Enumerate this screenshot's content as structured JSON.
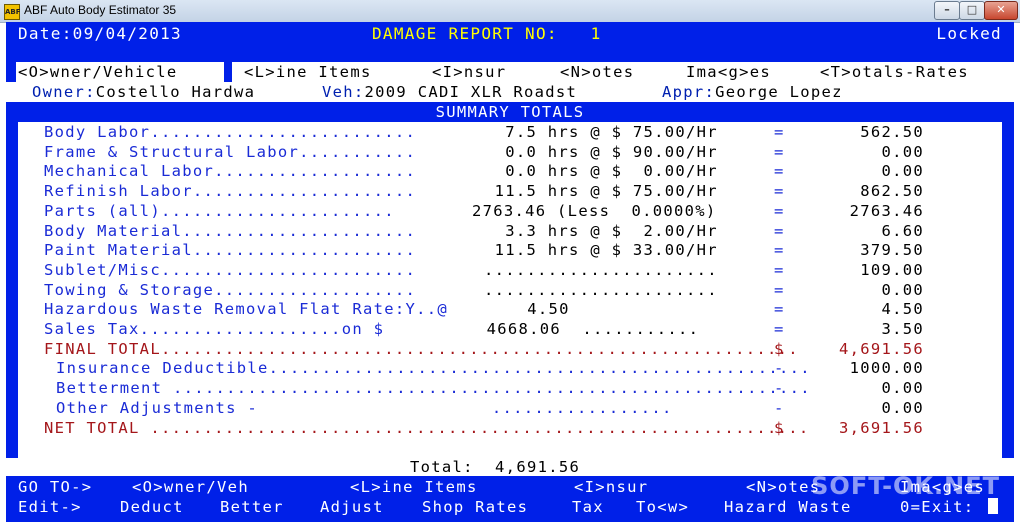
{
  "window": {
    "title": "ABF Auto Body Estimator 35",
    "icon": "abf-app-icon",
    "icon_text": "ABF"
  },
  "header": {
    "date": "Date:09/04/2013",
    "report": "DAMAGE REPORT NO:   1",
    "status": "Locked"
  },
  "tabs": [
    {
      "label": "<O>wner/Vehicle"
    },
    {
      "label": "<L>ine Items"
    },
    {
      "label": "<I>nsur"
    },
    {
      "label": "<N>otes"
    },
    {
      "label": "Ima<g>es"
    },
    {
      "label": "<T>otals-Rates"
    }
  ],
  "info": {
    "owner_label": "Owner:",
    "owner": "Costello Hardwa",
    "veh_label": "Veh:",
    "veh": "2009 CADI XLR Roadst",
    "appr_label": "Appr:",
    "appr": "George Lopez"
  },
  "summary_title": "SUMMARY TOTALS",
  "rows": [
    {
      "label": "Body Labor.........................",
      "mid": "  7.5 hrs @ $ 75.00/Hr",
      "eq": "=",
      "amount": "562.50"
    },
    {
      "label": "Frame & Structural Labor...........",
      "mid": "  0.0 hrs @ $ 90.00/Hr",
      "eq": "=",
      "amount": "0.00"
    },
    {
      "label": "Mechanical Labor...................",
      "mid": "  0.0 hrs @ $  0.00/Hr",
      "eq": "=",
      "amount": "0.00"
    },
    {
      "label": "Refinish Labor.....................",
      "mid": " 11.5 hrs @ $ 75.00/Hr",
      "eq": "=",
      "amount": "862.50"
    },
    {
      "label": "Parts (all)......................",
      "mid": "2763.46 (Less  0.0000%)",
      "eq": "=",
      "amount": "2763.46"
    },
    {
      "label": "Body Material......................",
      "mid": "  3.3 hrs @ $  2.00/Hr",
      "eq": "=",
      "amount": "6.60"
    },
    {
      "label": "Paint Material.....................",
      "mid": " 11.5 hrs @ $ 33.00/Hr",
      "eq": "=",
      "amount": "379.50"
    },
    {
      "label": "Sublet/Misc........................",
      "mid": "......................",
      "eq": "=",
      "amount": "109.00"
    },
    {
      "label": "Towing & Storage...................",
      "mid": "......................",
      "eq": "=",
      "amount": "0.00"
    },
    {
      "label": "Hazardous Waste Removal Flat Rate:Y..@",
      "mid": "  4.50",
      "eq": "=",
      "amount": "4.50"
    },
    {
      "label": "Sales Tax...................on $",
      "mid": " 4668.06  ...........",
      "eq": "=",
      "amount": "3.50"
    }
  ],
  "final": {
    "label": "FINAL TOTAL............................................................",
    "eq": "$",
    "amount": "4,691.56"
  },
  "adjustments": [
    {
      "label": "Insurance Deductible...................................................",
      "eq": "-",
      "amount": "1000.00"
    },
    {
      "label": "Betterment ............................................................",
      "eq": "-",
      "amount": "0.00"
    },
    {
      "label": "Other Adjustments -                      .................",
      "eq": "-",
      "amount": "0.00"
    }
  ],
  "net": {
    "label": "NET TOTAL ..............................................................",
    "eq": "$",
    "amount": "3,691.56"
  },
  "footer_total": "Total:  4,691.56",
  "menu1": {
    "goto": "GO TO->",
    "owner": "<O>wner/Veh",
    "line": "<L>ine Items",
    "insur": "<I>nsur",
    "notes": "<N>otes",
    "images": "Ima<g>es"
  },
  "menu2": {
    "edit": "Edit->",
    "deduct": "Deduct",
    "better": "Better",
    "adjust": "Adjust",
    "shop": "Shop Rates",
    "tax": "Tax",
    "tow": "To<w>",
    "haz": "Hazard Waste",
    "exit": "0=Exit:"
  },
  "watermark": "SOFT-OK.NET",
  "colors": {
    "bar_blue": "#0020e8",
    "label_blue": "#1a2bd6",
    "total_red": "#a4161a",
    "accent_yellow": "#ffff00"
  }
}
